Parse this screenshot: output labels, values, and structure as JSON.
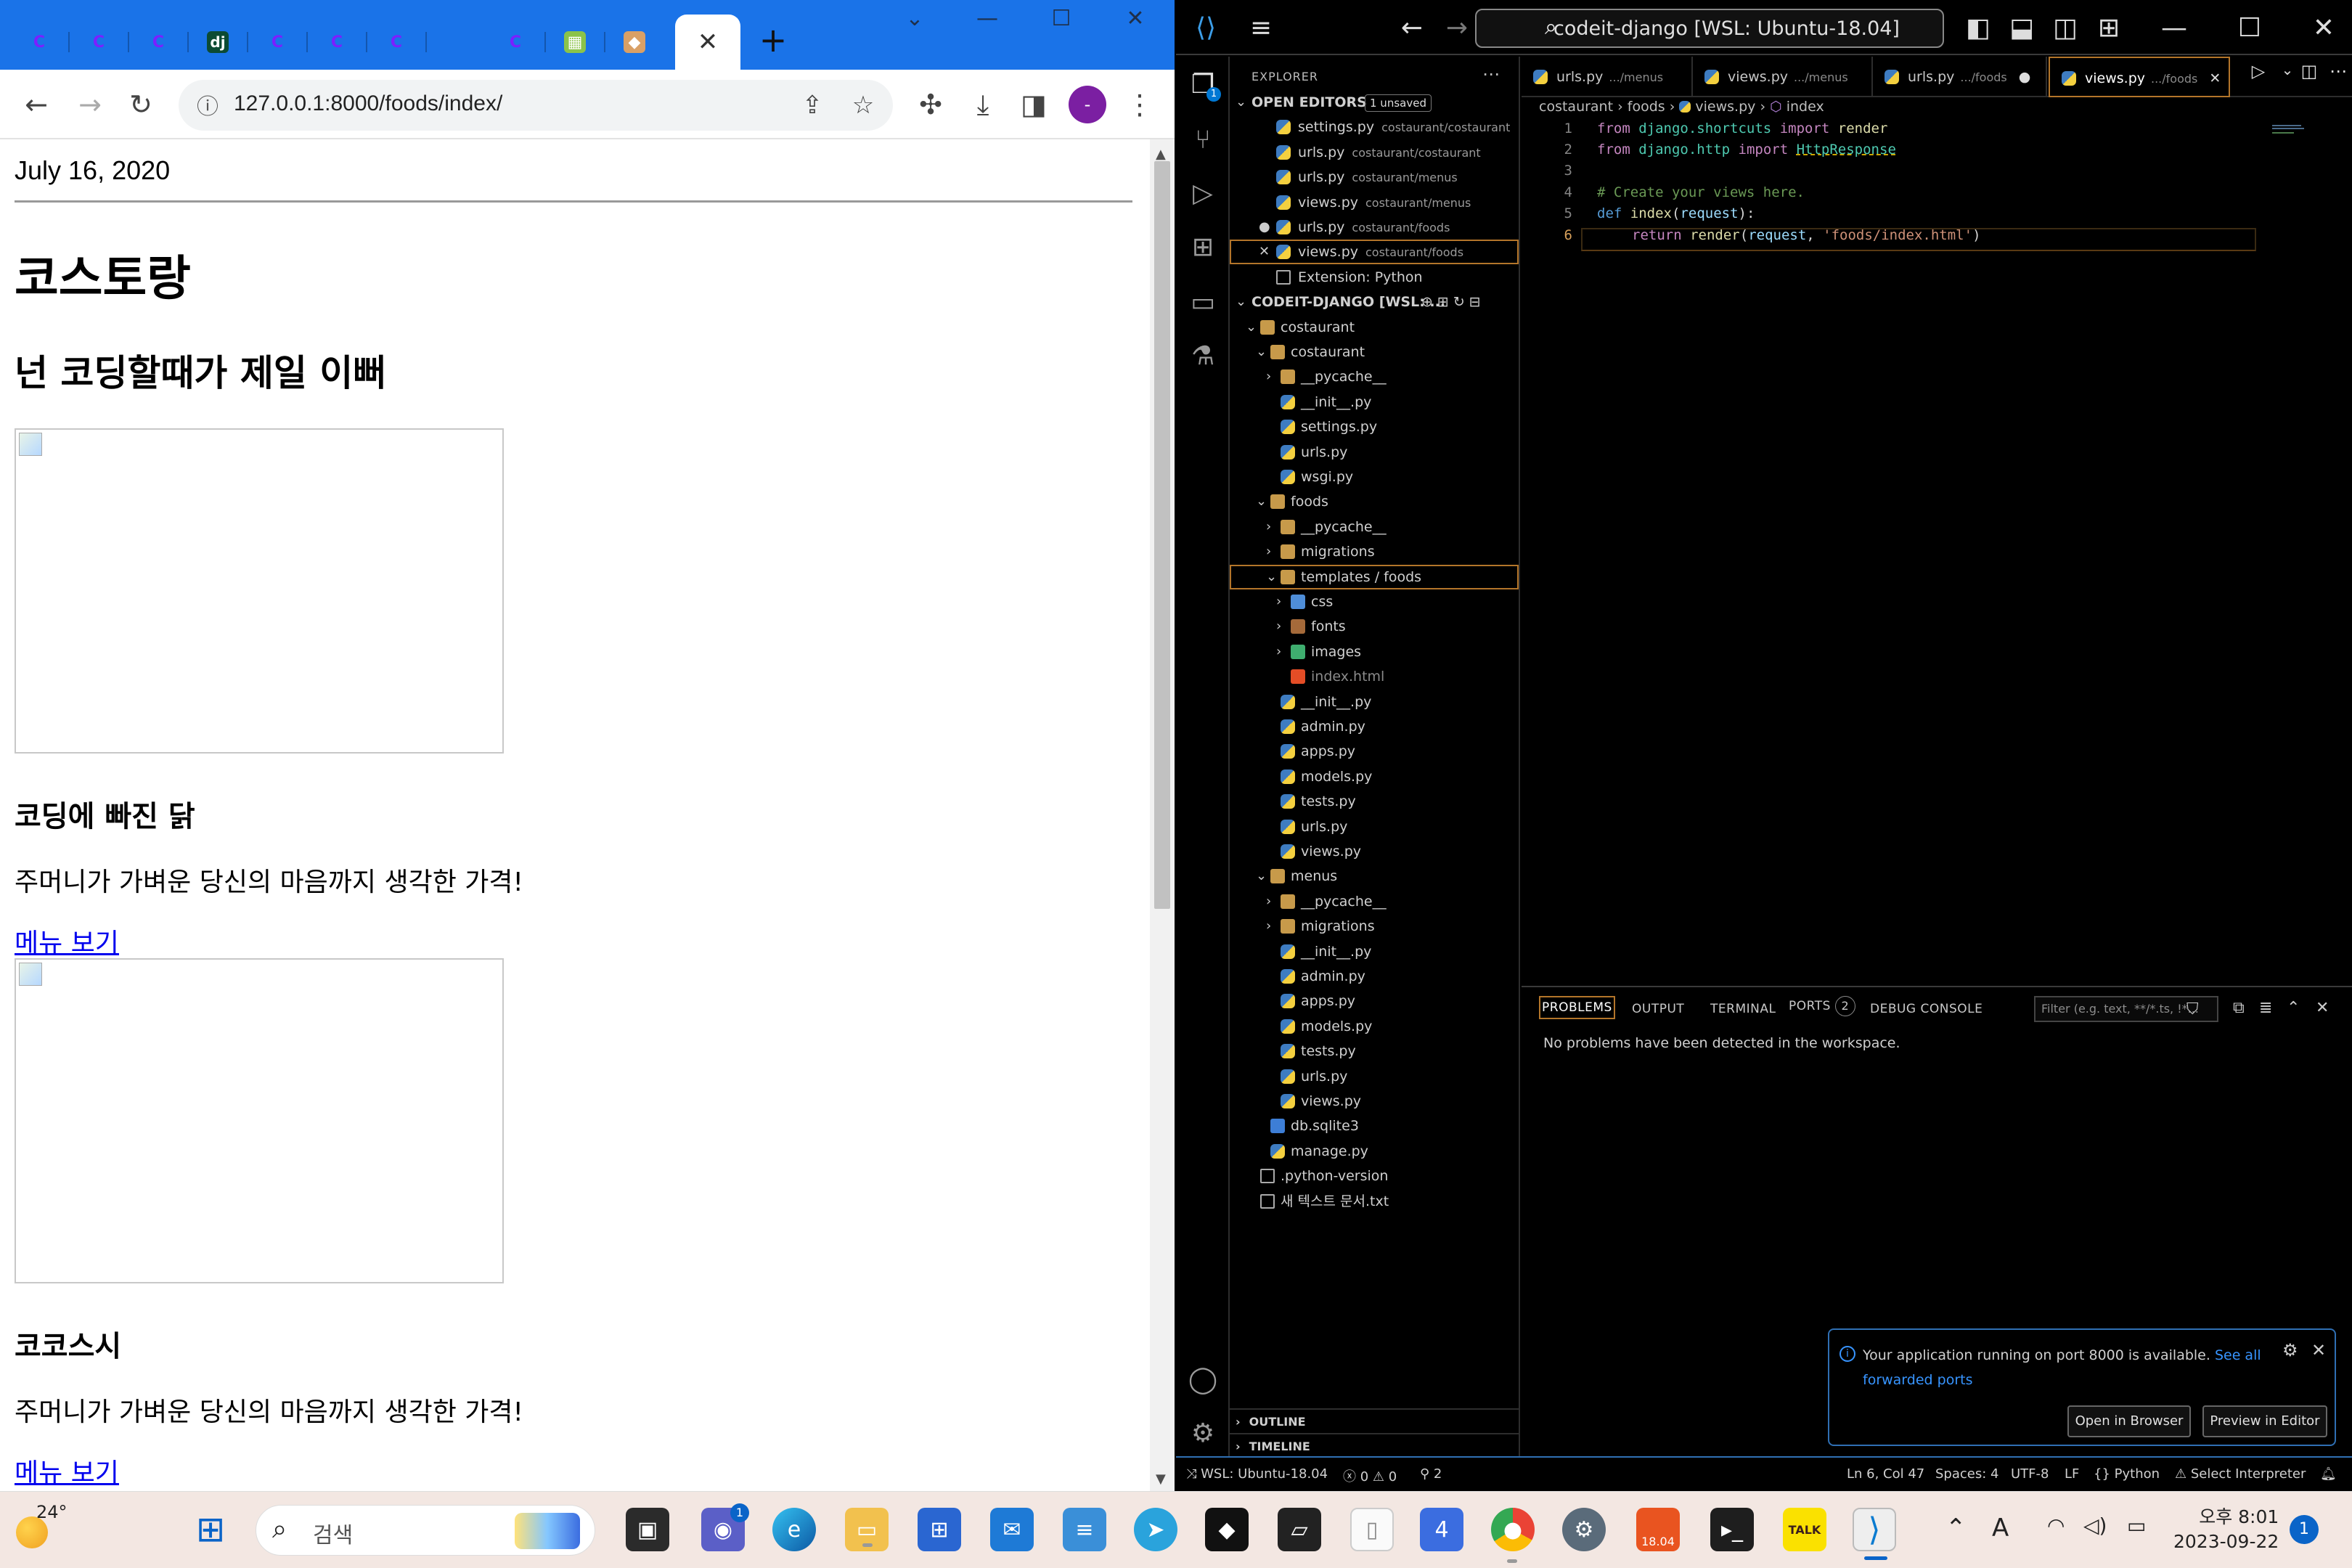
{
  "chrome": {
    "tabs": [
      {
        "icon": "codeit-icon",
        "glyph": "C"
      },
      {
        "icon": "codeit-icon",
        "glyph": "C"
      },
      {
        "icon": "codeit-icon",
        "glyph": "C"
      },
      {
        "icon": "django-icon",
        "glyph": "dj"
      },
      {
        "icon": "codeit-icon",
        "glyph": "C"
      },
      {
        "icon": "codeit-icon",
        "glyph": "C"
      },
      {
        "icon": "codeit-icon",
        "glyph": "C"
      },
      {
        "icon": "codeit-icon",
        "glyph": "C"
      },
      {
        "icon": "chart-favicon-icon",
        "glyph": "▦"
      },
      {
        "icon": "dish-favicon-icon",
        "glyph": "◆"
      }
    ],
    "url": "127.0.0.1:8000/foods/index/",
    "profile_initial": "-",
    "accent": "#1a73e8"
  },
  "page": {
    "date": "July 16, 2020",
    "h1": "코스토랑",
    "h2": "넌 코딩할때가 제일 이뻐",
    "foods": [
      {
        "title": "코딩에 빠진 닭",
        "desc": "주머니가 가벼운 당신의 마음까지 생각한 가격!",
        "link": "메뉴 보기"
      },
      {
        "title": "코코스시",
        "desc": "주머니가 가벼운 당신의 마음까지 생각한 가격!",
        "link": "메뉴 보기"
      }
    ]
  },
  "vscode": {
    "command_center": "codeit-django [WSL: Ubuntu-18.04]",
    "explorer_title": "EXPLORER",
    "open_editors": {
      "title": "OPEN EDITORS",
      "unsaved": "1 unsaved",
      "items": [
        {
          "name": "settings.py",
          "path": "costaurant/costaurant",
          "mark": ""
        },
        {
          "name": "urls.py",
          "path": "costaurant/costaurant",
          "mark": ""
        },
        {
          "name": "urls.py",
          "path": "costaurant/menus",
          "mark": ""
        },
        {
          "name": "views.py",
          "path": "costaurant/menus",
          "mark": ""
        },
        {
          "name": "urls.py",
          "path": "costaurant/foods",
          "mark": "●"
        },
        {
          "name": "views.py",
          "path": "costaurant/foods",
          "mark": "✕"
        },
        {
          "name": "Extension: Python",
          "path": "",
          "mark": ""
        }
      ]
    },
    "workspace": {
      "title": "CODEIT-DJANGO [WSL: ...",
      "tree": [
        {
          "label": "costaurant",
          "type": "folder",
          "depth": 0,
          "open": true
        },
        {
          "label": "costaurant",
          "type": "folder",
          "depth": 1,
          "open": true
        },
        {
          "label": "__pycache__",
          "type": "folder",
          "depth": 2,
          "open": false
        },
        {
          "label": "__init__.py",
          "type": "py",
          "depth": 2
        },
        {
          "label": "settings.py",
          "type": "py",
          "depth": 2
        },
        {
          "label": "urls.py",
          "type": "py",
          "depth": 2
        },
        {
          "label": "wsgi.py",
          "type": "py",
          "depth": 2
        },
        {
          "label": "foods",
          "type": "folder",
          "depth": 1,
          "open": true
        },
        {
          "label": "__pycache__",
          "type": "folder",
          "depth": 2,
          "open": false
        },
        {
          "label": "migrations",
          "type": "folder",
          "depth": 2,
          "open": false
        },
        {
          "label": "templates / foods",
          "type": "folder",
          "depth": 2,
          "open": true,
          "selected": true
        },
        {
          "label": "css",
          "type": "folder-blue",
          "depth": 3,
          "open": false
        },
        {
          "label": "fonts",
          "type": "folder-brown",
          "depth": 3,
          "open": false
        },
        {
          "label": "images",
          "type": "folder-green",
          "depth": 3,
          "open": false
        },
        {
          "label": "index.html",
          "type": "html",
          "depth": 3,
          "dim": true
        },
        {
          "label": "__init__.py",
          "type": "py",
          "depth": 2
        },
        {
          "label": "admin.py",
          "type": "py",
          "depth": 2
        },
        {
          "label": "apps.py",
          "type": "py",
          "depth": 2
        },
        {
          "label": "models.py",
          "type": "py",
          "depth": 2
        },
        {
          "label": "tests.py",
          "type": "py",
          "depth": 2
        },
        {
          "label": "urls.py",
          "type": "py",
          "depth": 2
        },
        {
          "label": "views.py",
          "type": "py",
          "depth": 2
        },
        {
          "label": "menus",
          "type": "folder",
          "depth": 1,
          "open": true
        },
        {
          "label": "__pycache__",
          "type": "folder",
          "depth": 2,
          "open": false
        },
        {
          "label": "migrations",
          "type": "folder",
          "depth": 2,
          "open": false
        },
        {
          "label": "__init__.py",
          "type": "py",
          "depth": 2
        },
        {
          "label": "admin.py",
          "type": "py",
          "depth": 2
        },
        {
          "label": "apps.py",
          "type": "py",
          "depth": 2
        },
        {
          "label": "models.py",
          "type": "py",
          "depth": 2
        },
        {
          "label": "tests.py",
          "type": "py",
          "depth": 2
        },
        {
          "label": "urls.py",
          "type": "py",
          "depth": 2
        },
        {
          "label": "views.py",
          "type": "py",
          "depth": 2
        },
        {
          "label": "db.sqlite3",
          "type": "db",
          "depth": 1
        },
        {
          "label": "manage.py",
          "type": "py",
          "depth": 1
        },
        {
          "label": ".python-version",
          "type": "txt",
          "depth": 0
        },
        {
          "label": "새 텍스트 문서.txt",
          "type": "txt",
          "depth": 0
        }
      ]
    },
    "outline": "OUTLINE",
    "timeline": "TIMELINE",
    "editor_tabs": [
      {
        "name": "urls.py",
        "path": ".../menus"
      },
      {
        "name": "views.py",
        "path": ".../menus"
      },
      {
        "name": "urls.py",
        "path": ".../foods",
        "dirty": "●"
      },
      {
        "name": "views.py",
        "path": ".../foods",
        "active": true,
        "close": "✕"
      }
    ],
    "breadcrumb": [
      "costaurant",
      "foods",
      "views.py",
      "index"
    ],
    "code": {
      "line1": {
        "n": "1",
        "k1": "from",
        "mod": "django.shortcuts",
        "k2": "import",
        "fn": "render"
      },
      "line2": {
        "n": "2",
        "k1": "from",
        "mod": "django.http",
        "k2": "import",
        "fn": "HttpResponse"
      },
      "line3": {
        "n": "3"
      },
      "line4": {
        "n": "4",
        "cmt": "# Create your views here."
      },
      "line5": {
        "n": "5",
        "k1": "def",
        "fn": "index",
        "arg": "request",
        "punct1": "(",
        "punct2": "):"
      },
      "line6": {
        "n": "6",
        "k1": "return",
        "fn": "render",
        "arg": "request",
        "str": "'foods/index.html'",
        "p1": "(",
        "p2": ", ",
        "p3": ")"
      }
    },
    "panel": {
      "tabs": [
        "PROBLEMS",
        "OUTPUT",
        "TERMINAL",
        "PORTS",
        "DEBUG CONSOLE"
      ],
      "ports_count": "2",
      "filter_placeholder": "Filter (e.g. text, **/*.ts, !*...",
      "message": "No problems have been detected in the workspace."
    },
    "notification": {
      "text": "Your application running on port 8000 is available.",
      "link": "See all forwarded ports",
      "btn_open": "Open in Browser",
      "btn_preview": "Preview in Editor"
    },
    "status": {
      "remote": "WSL: Ubuntu-18.04",
      "errors": "0",
      "warnings": "0",
      "ports": "2",
      "position": "Ln 6, Col 47",
      "spaces": "Spaces: 4",
      "encoding": "UTF-8",
      "eol": "LF",
      "language": "Python",
      "interpreter": "Select Interpreter"
    }
  },
  "taskbar": {
    "temperature": "24°",
    "search_label": "검색",
    "chat_badge": "1",
    "time": "오후 8:01",
    "date": "2023-09-22",
    "notifications": "1",
    "ubuntu_badge": "18.04",
    "kakao_label": "TALK"
  }
}
